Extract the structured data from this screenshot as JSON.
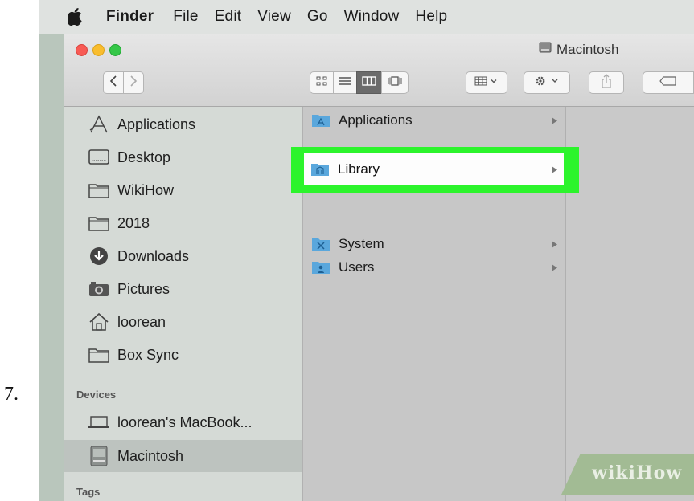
{
  "step_number": "7.",
  "menubar": {
    "apple_icon": "apple-icon",
    "items": [
      "Finder",
      "File",
      "Edit",
      "View",
      "Go",
      "Window",
      "Help"
    ]
  },
  "window": {
    "title": "Macintosh",
    "title_icon": "hard-drive-icon",
    "traffic_lights": {
      "close": "#f85b55",
      "minimize": "#f9bd2e",
      "zoom": "#35c748"
    }
  },
  "toolbar": {
    "back_icon": "chevron-left-icon",
    "forward_icon": "chevron-right-icon",
    "views": [
      "icon-view-icon",
      "list-view-icon",
      "column-view-icon",
      "cover-flow-icon"
    ],
    "active_view": "column-view-icon",
    "arrange_icon": "arrange-grid-icon",
    "action_icon": "gear-icon",
    "share_icon": "share-icon",
    "tag_icon": "tag-icon"
  },
  "sidebar": {
    "favorites": [
      {
        "label": "Applications",
        "icon": "applications-icon"
      },
      {
        "label": "Desktop",
        "icon": "desktop-icon"
      },
      {
        "label": "WikiHow",
        "icon": "folder-icon"
      },
      {
        "label": "2018",
        "icon": "folder-icon"
      },
      {
        "label": "Downloads",
        "icon": "downloads-icon"
      },
      {
        "label": "Pictures",
        "icon": "camera-icon"
      },
      {
        "label": "loorean",
        "icon": "home-icon"
      },
      {
        "label": "Box Sync",
        "icon": "folder-icon"
      }
    ],
    "devices_header": "Devices",
    "devices": [
      {
        "label": "loorean's MacBook...",
        "icon": "laptop-icon"
      },
      {
        "label": "Macintosh",
        "icon": "hard-drive-icon",
        "selected": true
      }
    ],
    "tags_header": "Tags"
  },
  "column": {
    "items": [
      {
        "label": "Applications",
        "icon": "applications-folder-icon"
      },
      {
        "label": "Library",
        "icon": "library-folder-icon",
        "highlighted": true
      },
      {
        "label": "System",
        "icon": "system-folder-icon"
      },
      {
        "label": "Users",
        "icon": "users-folder-icon"
      }
    ]
  },
  "highlight_color": "#2cf42c",
  "watermark": {
    "text": "wikiHow"
  }
}
